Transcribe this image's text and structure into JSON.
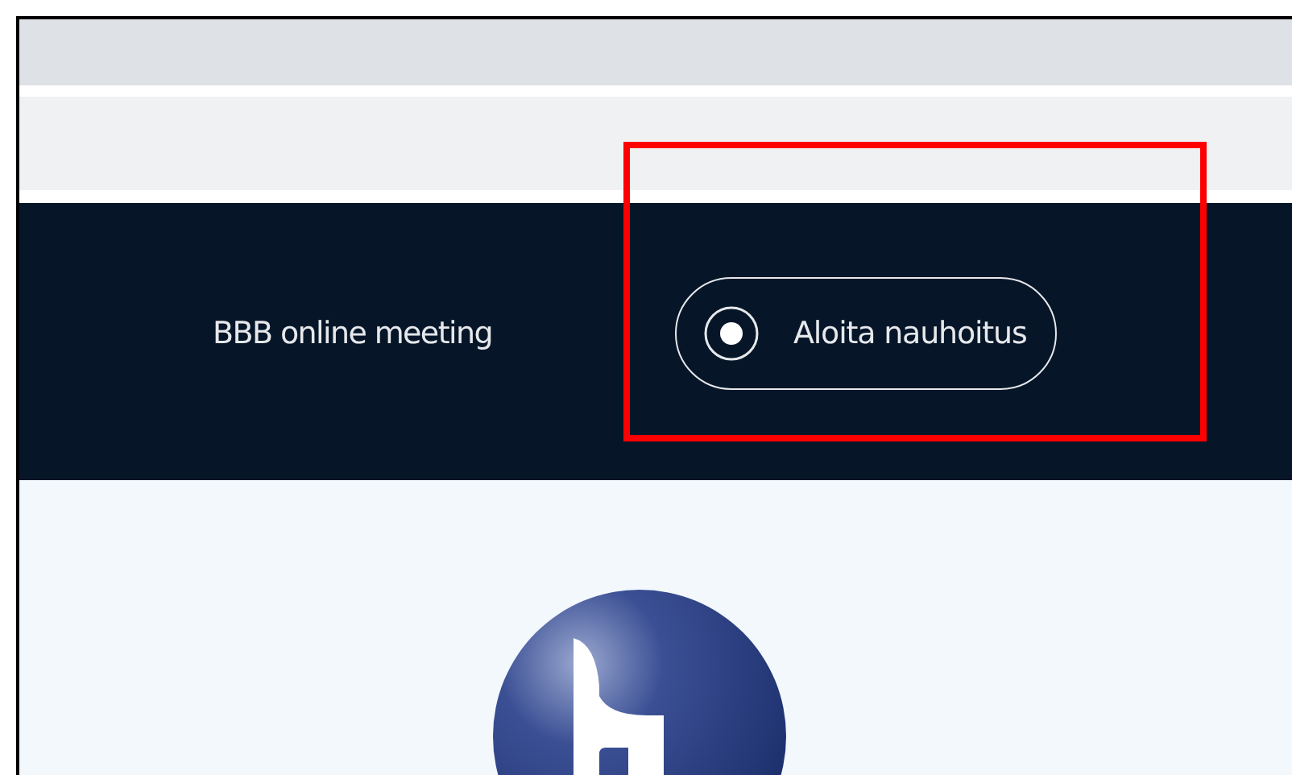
{
  "header": {
    "meeting_name": "BBB online meeting",
    "record_button": {
      "label": "Aloita nauhoitus"
    }
  }
}
